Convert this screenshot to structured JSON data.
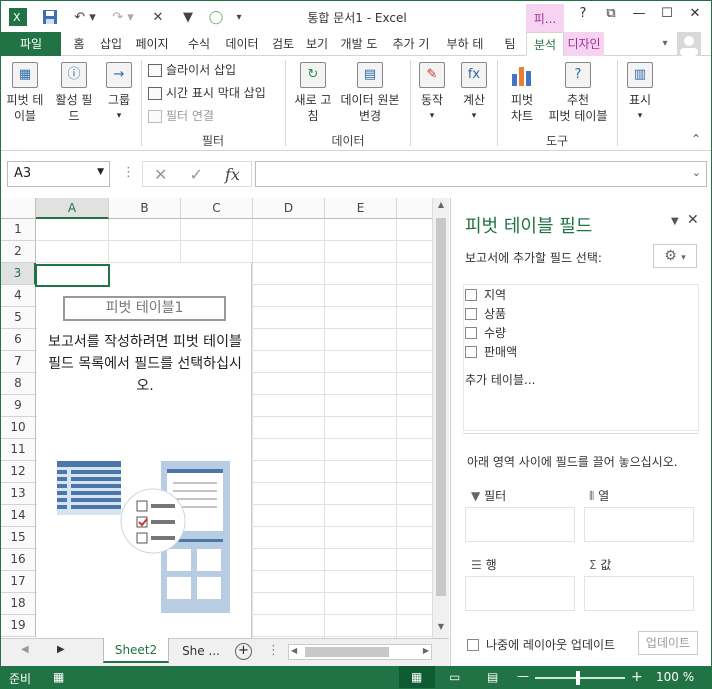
{
  "titlebar": {
    "title": "통합 문서1 - Excel",
    "context_tab": "피...",
    "window_help": "?"
  },
  "tabs": {
    "file": "파일",
    "items": [
      "홈",
      "삽입",
      "페이지",
      "수식",
      "데이터",
      "검토",
      "보기",
      "개발 도",
      "추가 기",
      "부하 테",
      "팀",
      "분석",
      "디자인"
    ]
  },
  "ribbon": {
    "pivot_table": "피벗 테\n이블",
    "active_field": "활성 필\n드",
    "group": "그룹",
    "insert_slicer": "슬라이서 삽입",
    "insert_timeline": "시간 표시 막대 삽입",
    "filter_connections": "필터 연결",
    "filter_group": "필터",
    "refresh": "새로 고\n침",
    "change_source": "데이터 원본\n변경",
    "data_group": "데이터",
    "actions": "동작",
    "calculations": "계산",
    "pivot_chart": "피벗\n차트",
    "recommended_pivot": "추천\n피벗 테이블",
    "tools_group": "도구",
    "show": "표시"
  },
  "formula_bar": {
    "name_box": "A3",
    "fx": "fx",
    "formula": ""
  },
  "grid": {
    "columns": [
      "A",
      "B",
      "C",
      "D",
      "E"
    ],
    "rows": [
      "1",
      "2",
      "3",
      "4",
      "5",
      "6",
      "7",
      "8",
      "9",
      "10",
      "11",
      "12",
      "13",
      "14",
      "15",
      "16",
      "17",
      "18",
      "19"
    ]
  },
  "pivot_placeholder": {
    "title": "피벗 테이블1",
    "message": "보고서를 작성하려면 피벗 테이블 필드 목록에서 필드를 선택하십시오."
  },
  "sheet_tabs": {
    "active": "Sheet2",
    "other": "She ...",
    "add": "+"
  },
  "field_pane": {
    "title": "피벗 테이블 필드",
    "subtitle": "보고서에 추가할 필드 선택:",
    "fields": [
      "지역",
      "상품",
      "수량",
      "판매액"
    ],
    "more_tables": "추가 테이블...",
    "drag_hint": "아래 영역 사이에 필드를 끌어 놓으십시오.",
    "areas": {
      "filter": "필터",
      "columns": "열",
      "rows": "행",
      "values": "값"
    },
    "defer_update": "나중에 레이아웃 업데이트",
    "update_button": "업데이트"
  },
  "status": {
    "ready": "준비",
    "zoom": "100 %"
  },
  "colors": {
    "accent": "#217346",
    "context_tab_bg": "#f6d4f1",
    "context_tab_text": "#a3309a"
  }
}
